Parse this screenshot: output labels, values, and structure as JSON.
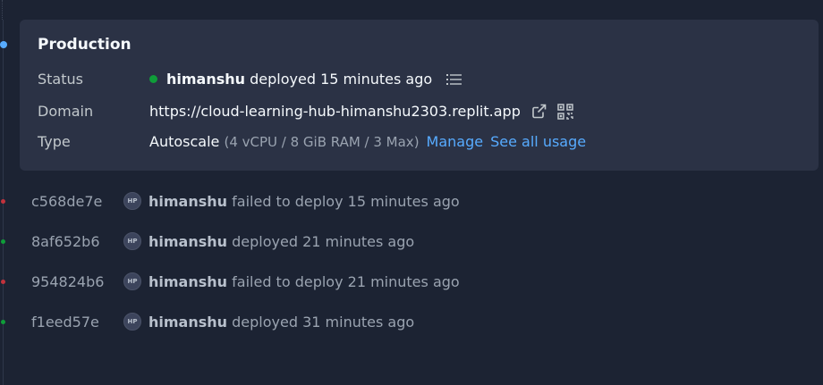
{
  "production": {
    "title": "Production",
    "status_label": "Status",
    "status_user": "himanshu",
    "status_text": "deployed 15 minutes ago",
    "domain_label": "Domain",
    "domain_value": "https://cloud-learning-hub-himanshu2303.replit.app",
    "type_label": "Type",
    "type_value": "Autoscale",
    "type_detail": "(4 vCPU / 8 GiB RAM / 3 Max)",
    "manage_link": "Manage",
    "usage_link": "See all usage"
  },
  "history": [
    {
      "hash": "c568de7e",
      "avatar": "HP",
      "user": "himanshu",
      "text": "failed to deploy 15 minutes ago",
      "status_color": "#c2323c"
    },
    {
      "hash": "8af652b6",
      "avatar": "HP",
      "user": "himanshu",
      "text": "deployed 21 minutes ago",
      "status_color": "#0f9d39"
    },
    {
      "hash": "954824b6",
      "avatar": "HP",
      "user": "himanshu",
      "text": "failed to deploy 21 minutes ago",
      "status_color": "#c2323c"
    },
    {
      "hash": "f1eed57e",
      "avatar": "HP",
      "user": "himanshu",
      "text": "deployed 31 minutes ago",
      "status_color": "#0f9d39"
    }
  ],
  "colors": {
    "background": "#1c2333",
    "card": "#2b3245",
    "accent": "#57abff",
    "success": "#0f9d39",
    "failure": "#c2323c"
  },
  "icons": {
    "log": "list-icon",
    "external": "external-link-icon",
    "qr": "qr-code-icon"
  }
}
